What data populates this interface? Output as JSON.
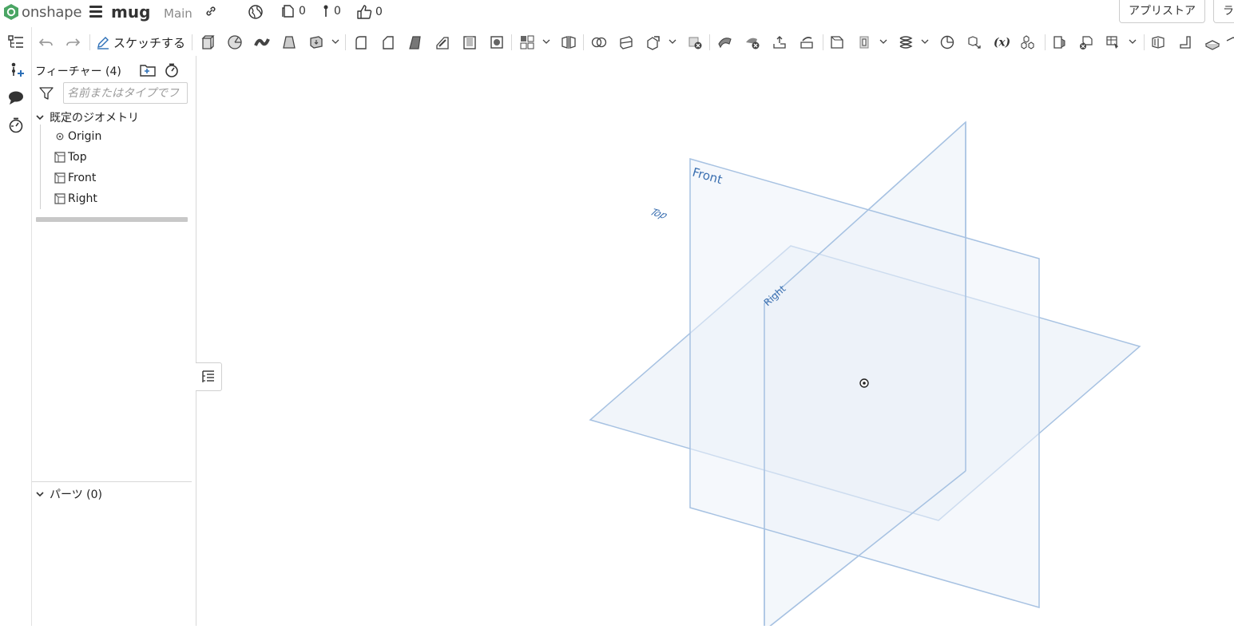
{
  "topbar": {
    "app_name": "onshape",
    "document_name": "mug",
    "workspace": "Main",
    "releases_count": "0",
    "versions_count": "0",
    "likes_count": "0",
    "appstore_label": "アプリストア",
    "learn_label": "ラ"
  },
  "toolbar": {
    "sketch_label": "スケッチする"
  },
  "feature_panel": {
    "title": "フィーチャー (4)",
    "search_placeholder": "名前またはタイプでフ",
    "default_geometry_label": "既定のジオメトリ",
    "items": [
      {
        "label": "Origin",
        "icon": "origin-icon"
      },
      {
        "label": "Top",
        "icon": "plane-icon"
      },
      {
        "label": "Front",
        "icon": "plane-icon"
      },
      {
        "label": "Right",
        "icon": "plane-icon"
      }
    ],
    "parts_label": "パーツ (0)"
  },
  "viewport": {
    "planes": {
      "front": "Front",
      "top": "Top",
      "right": "Right"
    },
    "plane_color": "#9fbde0",
    "plane_fill": "#e9f0f8",
    "label_color": "#3a6fb0"
  }
}
